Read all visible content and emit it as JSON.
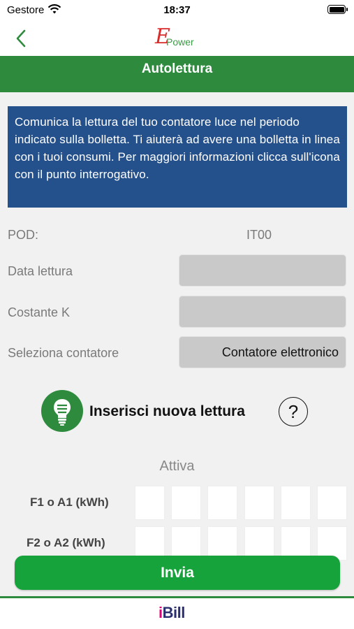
{
  "status": {
    "carrier": "Gestore",
    "time": "18:37",
    "battery_level": 1.0
  },
  "nav": {
    "logo_big": "E",
    "logo_small": "Power",
    "back_icon": "chevron-left-icon"
  },
  "header": {
    "title": "Autolettura"
  },
  "info": {
    "text": "Comunica la lettura del tuo contatore luce nel periodo indicato sulla bolletta. Ti aiuterà ad avere una bolletta in linea con i tuoi consumi. Per maggiori informazioni clicca sull'icona con il punto interrogativo."
  },
  "form": {
    "pod_label": "POD:",
    "pod_value": "IT00",
    "data_lettura_label": "Data lettura",
    "data_lettura_value": "",
    "costante_label": "Costante K",
    "costante_value": "",
    "contatore_label": "Seleziona contatore",
    "contatore_value": "Contatore elettronico"
  },
  "meter": {
    "title": "Inserisci nuova lettura",
    "help": "?",
    "icon": "lightbulb-icon"
  },
  "readings": {
    "section_label": "Attiva",
    "rows": [
      {
        "label": "F1 o A1 (kWh)",
        "digits": [
          "",
          "",
          "",
          "",
          "",
          ""
        ]
      },
      {
        "label": "F2 o A2 (kWh)",
        "digits": [
          "",
          "",
          "",
          "",
          "",
          ""
        ]
      }
    ]
  },
  "actions": {
    "send_label": "Invia"
  },
  "footer": {
    "brand_i": "i",
    "brand_rest": "Bill"
  },
  "colors": {
    "green": "#2e8b3e",
    "button_green": "#16a33b",
    "info_blue": "#24508b",
    "logo_red": "#d92b2b"
  }
}
